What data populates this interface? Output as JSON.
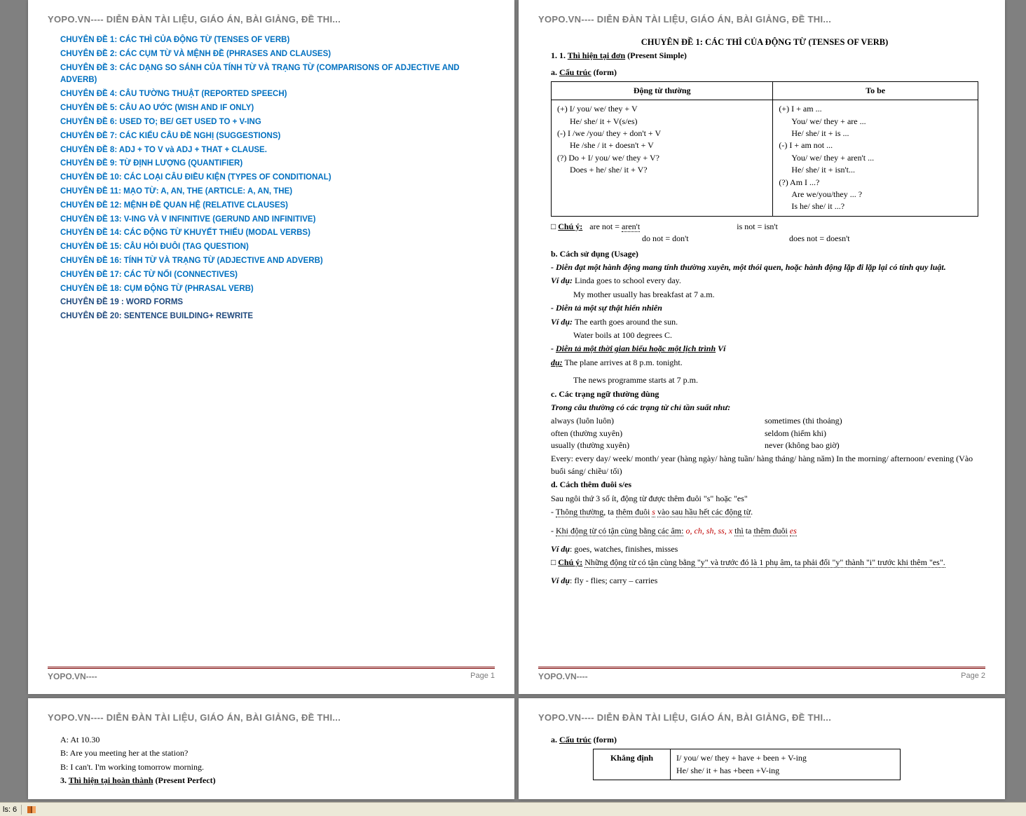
{
  "header": "YOPO.VN---- DIỄN ĐÀN TÀI LIỆU, GIÁO ÁN, BÀI GIẢNG, ĐỀ THI...",
  "footer_brand": "YOPO.VN----",
  "page_labels": {
    "p1": "Page 1",
    "p2": "Page 2"
  },
  "toc": [
    "CHUYÊN ĐỀ 1: CÁC THÌ CỦA ĐỘNG TỪ (TENSES OF VERB)",
    "CHUYÊN ĐỀ 2: CÁC CỤM TỪ VÀ MỆNH ĐỀ (PHRASES AND CLAUSES)",
    "CHUYÊN ĐỀ 3: CÁC DẠNG SO SÁNH CỦA TÍNH TỪ VÀ TRẠNG TỪ (COMPARISONS OF ADJECTIVE AND ADVERB)",
    "CHUYÊN ĐỀ 4: CÂU TƯỜNG THUẬT (REPORTED SPEECH)",
    "CHUYÊN ĐỀ 5: CÂU AO ƯỚC (WISH AND IF ONLY)",
    "CHUYÊN ĐỀ 6: USED TO; BE/ GET USED TO + V-ING",
    "CHUYÊN ĐỀ 7: CÁC KIỂU CÂU ĐỀ NGHỊ (SUGGESTIONS)",
    "CHUYÊN ĐỀ 8: ADJ + TO V và ADJ + THAT + CLAUSE.",
    "CHUYÊN ĐỀ 9: TỪ ĐỊNH LƯỢNG (QUANTIFIER)",
    "CHUYÊN ĐỀ 10: CÁC LOẠI CÂU ĐIỀU KIỆN (TYPES OF CONDITIONAL)",
    "CHUYÊN ĐỀ 11: MẠO TỪ: A, AN, THE (ARTICLE: A, AN, THE)",
    "CHUYÊN ĐỀ 12: MỆNH ĐỀ QUAN HỆ (RELATIVE CLAUSES)",
    "CHUYÊN ĐỀ 13: V-ING VÀ V INFINITIVE (GERUND AND INFINITIVE)",
    "CHUYÊN ĐỀ 14: CÁC ĐỘNG TỪ KHUYẾT THIẾU (MODAL VERBS)",
    "CHUYÊN ĐỀ 15: CÂU HỎI ĐUÔI (TAG QUESTION)",
    "CHUYÊN ĐỀ 16: TÍNH TỪ VÀ TRẠNG TỪ (ADJECTIVE AND ADVERB)",
    "CHUYÊN ĐỀ 17: CÁC TỪ NỐI (CONNECTIVES)",
    "CHUYÊN ĐỀ 18: CỤM ĐỘNG TỪ (PHRASAL VERB)",
    "CHUYÊN ĐỀ 19 : WORD FORMS",
    "CHUYÊN ĐỀ 20: SENTENCE BUILDING+ REWRITE"
  ],
  "p2": {
    "title": "CHUYÊN ĐỀ 1: CÁC THÌ CỦA ĐỘNG TỪ (TENSES OF VERB)",
    "h1": "1. Thì hiện tại đơn (Present Simple)",
    "sec_a": "a. Cấu trúc (form)",
    "table": {
      "h1": "Động từ thường",
      "h2": "To be",
      "c1": [
        "(+) I/ you/ we/ they + V",
        "    He/ she/ it + V(s/es)",
        "(-) I /we /you/ they + don't + V",
        "    He /she / it + doesn't + V",
        "(?) Do + I/ you/ we/ they + V?",
        "    Does + he/ she/ it + V?"
      ],
      "c2": [
        "(+) I + am ...",
        "    You/ we/ they + are ...",
        "    He/ she/ it + is ...",
        "(-) I + am not ...",
        "    You/ we/ they + aren't ...",
        "    He/ she/ it + isn't...",
        "(?) Am I ...?",
        "    Are we/you/they ... ?",
        "    Is he/ she/ it ...?"
      ]
    },
    "note_label": "Chú ý:",
    "note1a": "are not = aren't",
    "note1b": "is not = isn't",
    "note2a": "do not = don't",
    "note2b": "does not = doesn't",
    "sec_b": "b. Cách sử dụng (Usage)",
    "u1": "- Diễn đạt một hành động mang tính thường xuyên, một thói quen, hoặc hành động lặp đi lặp lại có tính quy luật.",
    "u1ex_label": "Ví dụ:",
    "u1ex1": "Linda goes to school every day.",
    "u1ex2": "My mother usually has breakfast at 7 a.m.",
    "u2": "- Diễn tả một sự thật hiển nhiên",
    "u2ex1": "The earth goes around the sun.",
    "u2ex2": "Water boils at 100 degrees C.",
    "u3": "- Diễn tả một thời gian biểu hoặc một lịch trình Ví",
    "u3b": "dụ:",
    "u3ex1": "The plane arrives at 8 p.m. tonight.",
    "u3ex2": "The news programme starts at 7 p.m.",
    "sec_c": "c. Các trạng ngữ thường dùng",
    "c_lead": "Trong câu thường có các trạng từ chỉ tần suất như:",
    "adv": {
      "l1": "always (luôn luôn)",
      "r1": "sometimes (thi thoảng)",
      "l2": "often (thường xuyên)",
      "r2": "seldom (hiếm khi)",
      "l3": "usually (thường xuyên)",
      "r3": "never (không bao giờ)"
    },
    "every": "Every: every day/ week/ month/ year (hàng ngày/ hàng tuần/ hàng tháng/ hàng năm) In the morning/ afternoon/ evening (Vào buổi sáng/ chiều/ tối)",
    "sec_d": "d. Cách thêm đuôi s/es",
    "d1": "Sau ngôi thứ 3 số ít, động từ được thêm đuôi \"s\" hoặc \"es\"",
    "d2a": "- Thông thường, ta thêm đuôi ",
    "d2b": "s",
    "d2c": " vào sau hầu hết các động từ.",
    "d3a": "- Khi động từ có tận cùng bằng các âm: ",
    "d3b": "o, ch, sh, ss, x",
    "d3c": " thì ta thêm đuôi ",
    "d3d": "es",
    "d_ex": "goes, watches, finishes, misses",
    "d_note": "Những động từ có tận cùng bằng \"y\" và trước đó là 1 phụ âm, ta phải đổi \"y\" thành \"i\" trước khi thêm \"es\".",
    "d_ex2": "fly - flies; carry – carries"
  },
  "p3": {
    "l1": "A: At 10.30",
    "l2": "B: Are you meeting her at the station?",
    "l3": "B: I can't. I'm working tomorrow morning.",
    "l4": "3. Thì hiện tại hoàn thành (Present Perfect)"
  },
  "p4": {
    "sec_a": "a. Cấu trúc (form)",
    "th1": "Khẳng định",
    "r1": "I/ you/ we/ they + have + been + V-ing",
    "r2": "He/ she/ it + has +been +V-ing"
  },
  "status": {
    "count_label": "ls: 6"
  }
}
